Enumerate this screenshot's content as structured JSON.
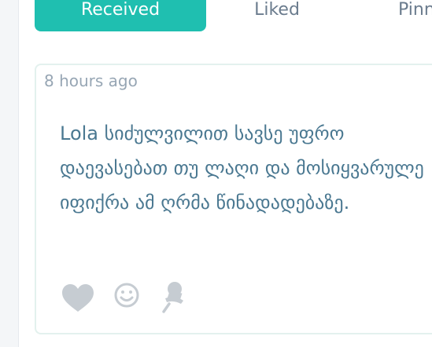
{
  "tabs": {
    "received": "Received",
    "liked": "Liked",
    "pinned": "Pinn"
  },
  "post": {
    "time": "8 hours ago",
    "message": "Lola სიძულვილით სავსე უფრო დაევასებათ თუ ლაღი და მოსიყვარულე იფიქრა ამ ღრმა წინადადებაზე."
  },
  "icons": {
    "like": "heart-icon",
    "react": "smiley-icon",
    "pin": "pushpin-icon"
  },
  "colors": {
    "accent": "#1fbfb0",
    "message_text": "#4a7891",
    "muted_text": "#97a6b4",
    "icon": "#c6ccd2"
  }
}
